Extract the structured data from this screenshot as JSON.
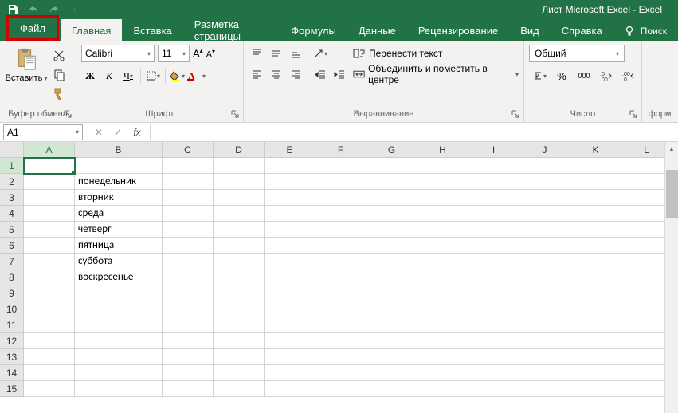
{
  "title": "Лист Microsoft Excel  -  Excel",
  "tabs": {
    "file": "Файл",
    "home": "Главная",
    "insert": "Вставка",
    "pagelayout": "Разметка страницы",
    "formulas": "Формулы",
    "data": "Данные",
    "review": "Рецензирование",
    "view": "Вид",
    "help": "Справка",
    "search": "Поиск"
  },
  "ribbon": {
    "clipboard": {
      "label": "Буфер обмена",
      "paste": "Вставить"
    },
    "font": {
      "label": "Шрифт",
      "name": "Calibri",
      "size": "11",
      "bold": "Ж",
      "italic": "К",
      "underline": "Ч"
    },
    "alignment": {
      "label": "Выравнивание",
      "wrap": "Перенести текст",
      "merge": "Объединить и поместить в центре"
    },
    "number": {
      "label": "Число",
      "format": "Общий",
      "percent": "%",
      "comma": "000"
    },
    "format_section": "форм"
  },
  "namebox": "A1",
  "fx": "fx",
  "columns": [
    "A",
    "B",
    "C",
    "D",
    "E",
    "F",
    "G",
    "H",
    "I",
    "J",
    "K",
    "L"
  ],
  "rows": [
    "1",
    "2",
    "3",
    "4",
    "5",
    "6",
    "7",
    "8",
    "9",
    "10",
    "11",
    "12",
    "13",
    "14",
    "15"
  ],
  "selected_col": "A",
  "selected_row": "1",
  "cells": {
    "B2": "понедельник",
    "B3": "вторник",
    "B4": "среда",
    "B5": "четверг",
    "B6": "пятница",
    "B7": "суббота",
    "B8": "воскресенье"
  }
}
